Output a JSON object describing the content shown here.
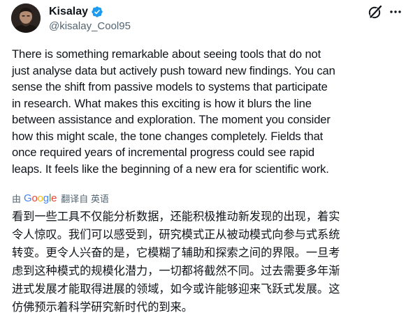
{
  "author": {
    "display_name": "Kisalay",
    "handle": "@kisalay_Cool95",
    "verified_icon": "verified-badge-icon",
    "avatar": "profile-photo"
  },
  "header_icons": {
    "grok": "grok-icon",
    "more": "more-options-icon"
  },
  "post": {
    "text": "There is something remarkable about seeing tools that do not\njust analyse data but actively push toward new findings. You can\nsense the shift from passive models to systems that participate\nin research. What makes this exciting is how it blurs the line\nbetween assistance and exploration. The moment you consider\nhow this might scale, the tone changes completely. Fields that\nonce required years of incremental progress could see rapid\nleaps. It feels like the beginning of a new era for scientific work."
  },
  "translation": {
    "prefix": "由",
    "provider": "Google",
    "action": "翻译自 英语",
    "text": "看到一些工具不仅能分析数据，还能积极推动新发现的出现，着实\n令人惊叹。我们可以感受到，研究模式正从被动模式向参与式系统\n转变。更令人兴奋的是，它模糊了辅助和探索之间的界限。一旦考\n虑到这种模式的规模化潜力，一切都将截然不同。过去需要多年渐\n进式发展才能取得进展的领域，如今或许能够迎来飞跃式发展。这\n仿佛预示着科学研究新时代的到来。"
  },
  "colors": {
    "verified": "#1d9bf0",
    "secondary_text": "#536471",
    "primary_text": "#0f1419"
  }
}
